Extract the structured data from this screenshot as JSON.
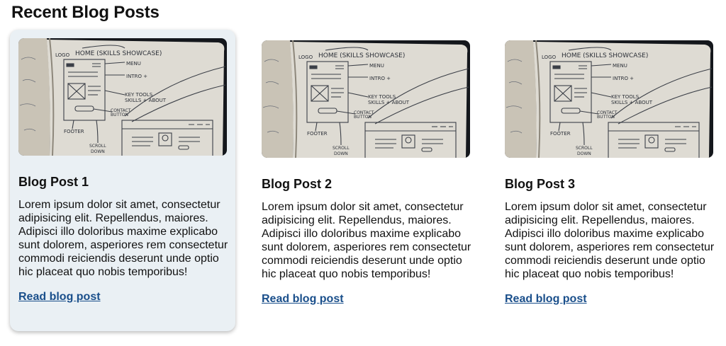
{
  "page": {
    "title": "Recent Blog Posts"
  },
  "posts": [
    {
      "title": "Blog Post 1",
      "text": "Lorem ipsum dolor sit amet, consectetur adipisicing elit. Repellendus, maiores. Adipisci illo doloribus maxime explicabo sunt dolorem, asperiores rem consectetur commodi reiciendis deserunt unde optio hic placeat quo nobis temporibus!",
      "link": "Read blog post",
      "image": "notebook-wireframe-sketch-photo"
    },
    {
      "title": "Blog Post 2",
      "text": "Lorem ipsum dolor sit amet, consectetur adipisicing elit. Repellendus, maiores. Adipisci illo doloribus maxime explicabo sunt dolorem, asperiores rem consectetur commodi reiciendis deserunt unde optio hic placeat quo nobis temporibus!",
      "link": "Read blog post",
      "image": "notebook-wireframe-sketch-photo"
    },
    {
      "title": "Blog Post 3",
      "text": "Lorem ipsum dolor sit amet, consectetur adipisicing elit. Repellendus, maiores. Adipisci illo doloribus maxime explicabo sunt dolorem, asperiores rem consectetur commodi reiciendis deserunt unde optio hic placeat quo nobis temporibus!",
      "link": "Read blog post",
      "image": "notebook-wireframe-sketch-photo"
    }
  ],
  "sketch_labels": {
    "home": "HOME (SKILLS SHOWCASE)",
    "logo": "LOGO",
    "menu": "MENU",
    "intro": "INTRO +",
    "key": "KEY TOOLS",
    "skills": "SKILLS + ABOUT",
    "contact": "CONTACT",
    "button": "BUTTON",
    "footer": "FOOTER",
    "scroll": "SCROLL",
    "down": "DOWN"
  },
  "colors": {
    "accent_link": "#1a4f8b",
    "active_card_bg": "#eaf0f4"
  }
}
